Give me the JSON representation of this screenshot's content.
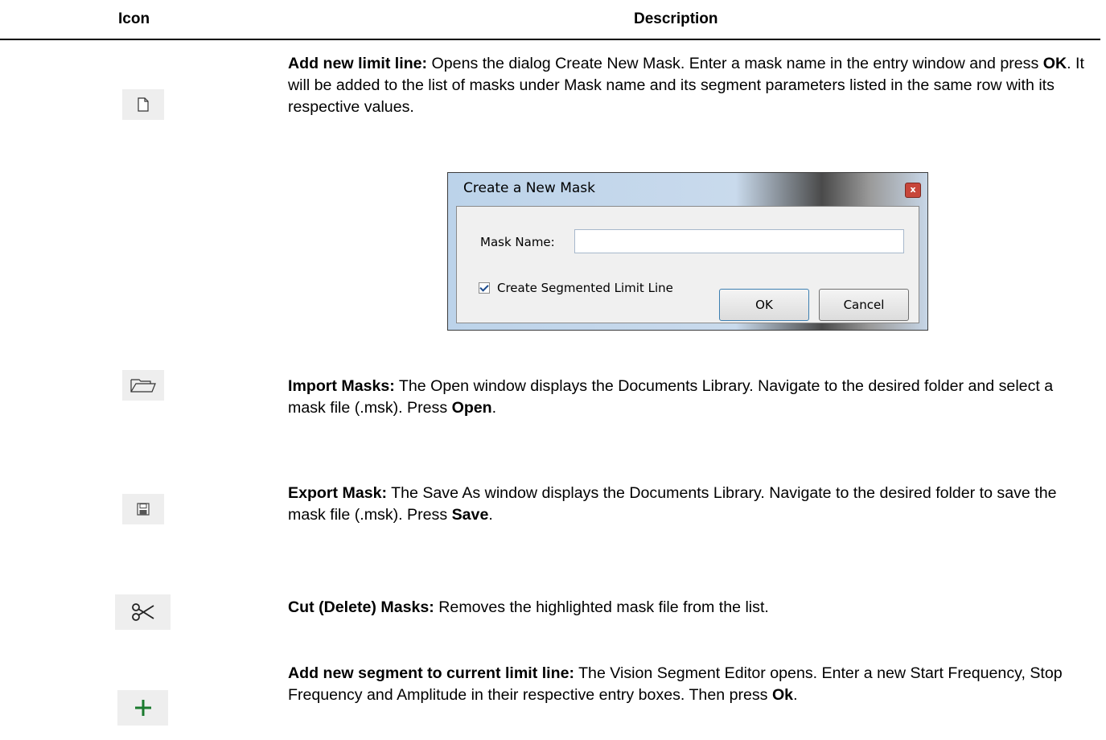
{
  "headers": {
    "icon": "Icon",
    "description": "Description"
  },
  "rows": [
    {
      "icon": "new-file-icon",
      "title": "Add new limit line:",
      "parts": [
        " Opens the dialog Create New Mask. Enter a mask name in the entry window and press ",
        "OK",
        ". It will be added to the list of masks under Mask name and its segment parameters listed in the same row with its respective values."
      ]
    },
    {
      "icon": "open-folder-icon",
      "title": "Import Masks:",
      "parts": [
        " The Open window displays the Documents Library. Navigate to the desired folder and select a mask file (.msk). Press ",
        "Open",
        "."
      ]
    },
    {
      "icon": "floppy-disk-icon",
      "title": "Export Mask:",
      "parts": [
        " The Save As window displays the Documents Library. Navigate to the desired folder to save the mask file (.msk). Press ",
        "Save",
        "."
      ]
    },
    {
      "icon": "scissors-icon",
      "title": "Cut (Delete) Masks:",
      "parts": [
        " Removes the highlighted mask file from the list.",
        "",
        ""
      ]
    },
    {
      "icon": "plus-icon",
      "title": "Add new segment to current limit line:",
      "parts": [
        " The Vision Segment Editor opens. Enter a new Start Frequency, Stop Frequency and Amplitude in their respective entry boxes. Then press ",
        "Ok",
        "."
      ]
    }
  ],
  "dialog": {
    "title": "Create a New Mask",
    "close_glyph": "x",
    "mask_name_label": "Mask Name:",
    "mask_name_value": "",
    "checkbox_label": "Create Segmented Limit Line",
    "ok_label": "OK",
    "cancel_label": "Cancel"
  }
}
